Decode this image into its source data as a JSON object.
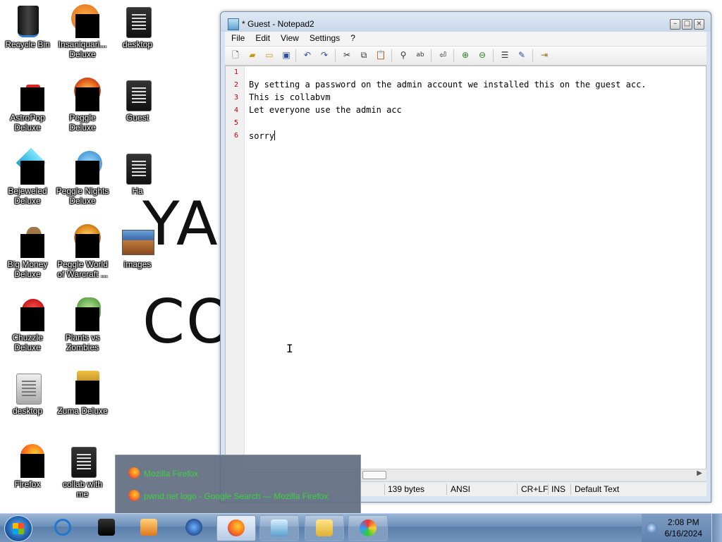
{
  "desktop": {
    "background_text": [
      "YA",
      "CO"
    ],
    "icons": [
      {
        "label": "Recycle Bin"
      },
      {
        "label": "Insaniquari...\nDeluxe"
      },
      {
        "label": "desktop"
      },
      {
        "label": "AstroPop\nDeluxe"
      },
      {
        "label": "Peggle Deluxe"
      },
      {
        "label": "Guest"
      },
      {
        "label": "Bejeweled\nDeluxe"
      },
      {
        "label": "Peggle Nights\nDeluxe"
      },
      {
        "label": "Ha"
      },
      {
        "label": "Big Money\nDeluxe"
      },
      {
        "label": "Peggle World\nof Warcraft ..."
      },
      {
        "label": "images"
      },
      {
        "label": "Chuzzle\nDeluxe"
      },
      {
        "label": "Plants vs\nZombies"
      },
      {
        "label": "desktop"
      },
      {
        "label": "Zuma Deluxe"
      },
      {
        "label": "Firefox"
      },
      {
        "label": "collab with\nme"
      }
    ]
  },
  "window": {
    "title": "* Guest - Notepad2",
    "menu": [
      "File",
      "Edit",
      "View",
      "Settings",
      "?"
    ],
    "editor": {
      "line_numbers": [
        "1",
        "2",
        "3",
        "4",
        "5",
        "6"
      ],
      "lines": [
        "",
        "By setting a password on the admin account we installed this on the guest acc.",
        "This is collabvm",
        "Let everyone use the admin acc",
        "",
        "sorry"
      ]
    },
    "status": {
      "size": "139 bytes",
      "encoding": "ANSI",
      "line_ending": "CR+LF",
      "mode": "INS",
      "scheme": "Default Text"
    }
  },
  "popup": {
    "items": [
      {
        "label": "Mozilla Firefox"
      },
      {
        "label": "pwnd.net logo - Google Search — Mozilla Firefox"
      }
    ]
  },
  "taskbar": {
    "clock_time": "2:08 PM",
    "clock_date": "6/16/2024",
    "accent": "#6c8fb8"
  }
}
